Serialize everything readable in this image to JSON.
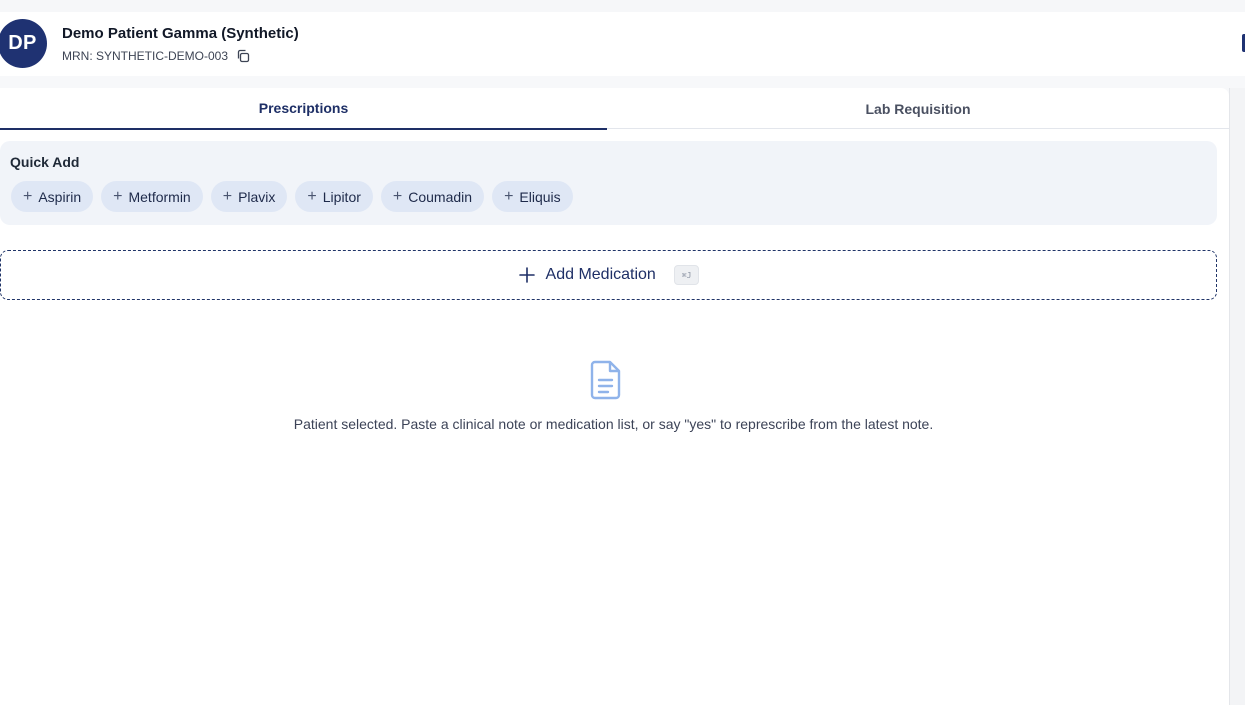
{
  "patient": {
    "initials": "DP",
    "name": "Demo Patient Gamma (Synthetic)",
    "mrn": "MRN: SYNTHETIC-DEMO-003"
  },
  "tabs": [
    {
      "label": "Prescriptions",
      "active": true
    },
    {
      "label": "Lab Requisition",
      "active": false
    }
  ],
  "quick_add": {
    "title": "Quick Add",
    "items": [
      {
        "label": "Aspirin"
      },
      {
        "label": "Metformin"
      },
      {
        "label": "Plavix"
      },
      {
        "label": "Lipitor"
      },
      {
        "label": "Coumadin"
      },
      {
        "label": "Eliquis"
      }
    ]
  },
  "add_medication": {
    "label": "Add Medication",
    "shortcut": "⌘J"
  },
  "empty_state": {
    "icon": "document-icon",
    "message": "Patient selected. Paste a clinical note or medication list, or say \"yes\" to represcribe from the latest note."
  },
  "colors": {
    "brand": "#1f3272",
    "accent": "#1e2f66",
    "chip_bg": "#dfe7f5",
    "quick_add_bg": "#f1f4f9",
    "empty_icon": "#8fb3ea"
  }
}
